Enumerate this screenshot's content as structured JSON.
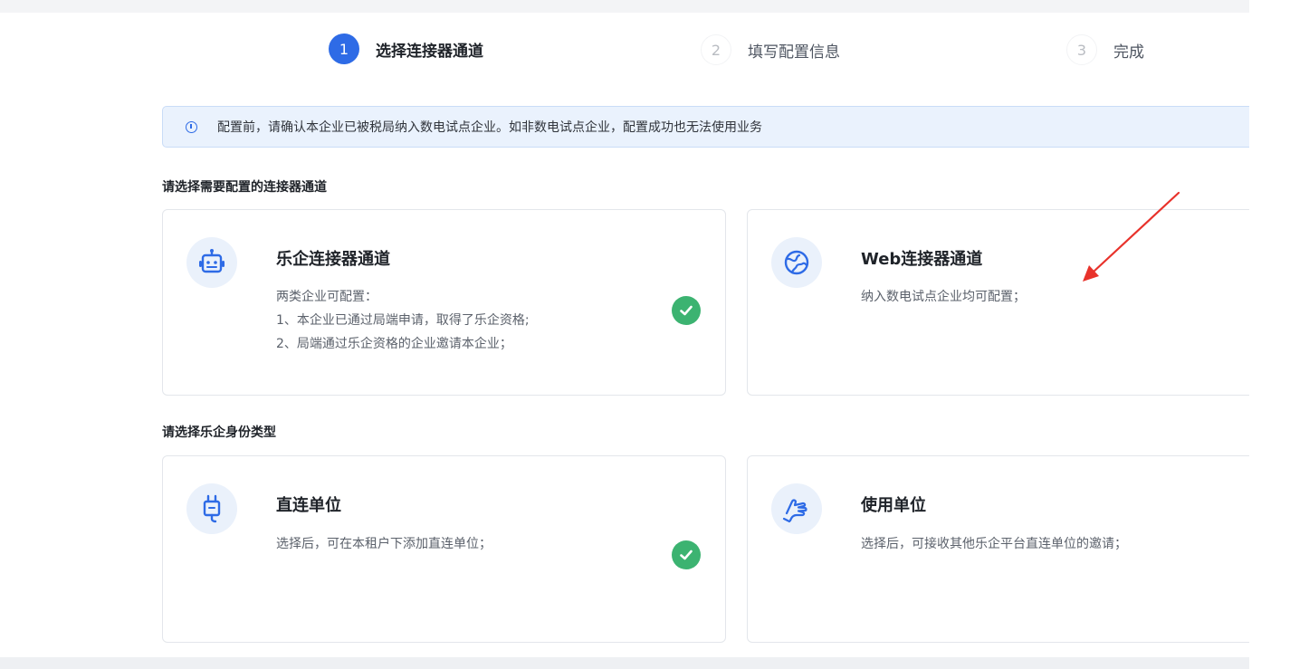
{
  "steps": [
    {
      "number": "1",
      "label": "选择连接器通道",
      "state": "active"
    },
    {
      "number": "2",
      "label": "填写配置信息",
      "state": "idle"
    },
    {
      "number": "3",
      "label": "完成",
      "state": "idle"
    }
  ],
  "notice": {
    "icon": "info-circle-icon",
    "text": "配置前，请确认本企业已被税局纳入数电试点企业。如非数电试点企业，配置成功也无法使用业务"
  },
  "connector_section": {
    "title": "请选择需要配置的连接器通道",
    "cards": [
      {
        "title": "乐企连接器通道",
        "icon": "robot-icon",
        "selected": true,
        "desc": [
          "两类企业可配置：",
          "1、本企业已通过局端申请，取得了乐企资格;",
          "2、局端通过乐企资格的企业邀请本企业；"
        ]
      },
      {
        "title": "Web连接器通道",
        "icon": "globe-icon",
        "selected": false,
        "desc": [
          "纳入数电试点企业均可配置；"
        ]
      }
    ]
  },
  "identity_section": {
    "title": "请选择乐企身份类型",
    "cards": [
      {
        "title": "直连单位",
        "icon": "plug-icon",
        "selected": true,
        "desc": [
          "选择后，可在本租户下添加直连单位；"
        ]
      },
      {
        "title": "使用单位",
        "icon": "hand-icon",
        "selected": false,
        "desc": [
          "选择后，可接收其他乐企平台直连单位的邀请；"
        ]
      }
    ]
  },
  "colors": {
    "accent": "#2e6be6",
    "success": "#3cb371",
    "annotation_arrow": "#e8322b"
  }
}
